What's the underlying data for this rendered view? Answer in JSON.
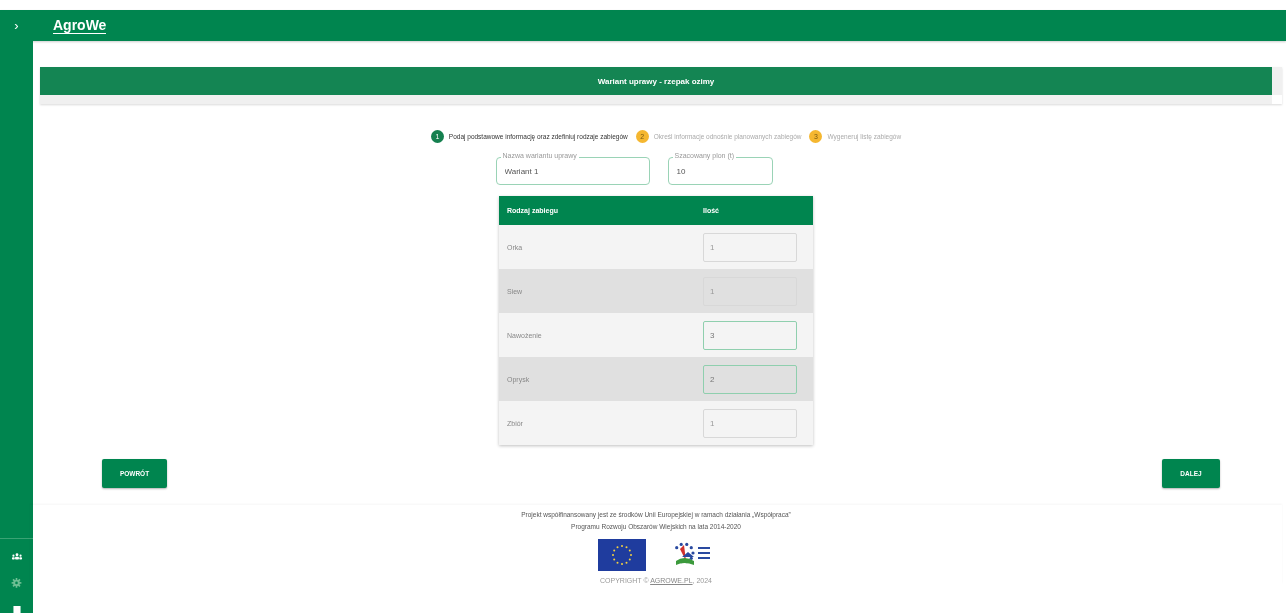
{
  "app": {
    "brand": "AgroWe",
    "menu_toggle": "›"
  },
  "banner": {
    "title": "Wariant uprawy - rzepak ozimy"
  },
  "steps": [
    {
      "number": "1",
      "label": "Podaj podstawowe informację oraz zdefiniuj rodzaje zabiegów",
      "selected": true
    },
    {
      "number": "2",
      "label": "Określ informacje odnośnie planowanych zabiegów",
      "selected": false
    },
    {
      "number": "3",
      "label": "Wygeneruj listę zabiegów",
      "selected": false
    }
  ],
  "fields": [
    {
      "label": "Nazwa wariantu uprawy",
      "value": "Wariant 1"
    },
    {
      "label": "Szacowany plon (t)",
      "value": "10"
    }
  ],
  "table": {
    "columns": [
      "Rodzaj zabiegu",
      "Ilość"
    ],
    "rows": [
      {
        "name": "Orka",
        "value": "1",
        "disabled": true
      },
      {
        "name": "Siew",
        "value": "1",
        "disabled": true
      },
      {
        "name": "Nawożenie",
        "value": "3",
        "disabled": false
      },
      {
        "name": "Oprysk",
        "value": "2",
        "disabled": false
      },
      {
        "name": "Zbiór",
        "value": "1",
        "disabled": true
      }
    ]
  },
  "buttons": {
    "back": "POWRÓT",
    "next": "DALEJ"
  },
  "footer": {
    "text_lines": [
      "Projekt współfinansowany jest ze środków Unii Europejskiej w ramach działania „Współpraca”",
      "Programu Rozwoju Obszarów Wiejskich na lata 2014-2020"
    ],
    "copyright_prefix": "COPYRIGHT © ",
    "copyright_link": "AGROWE.PL",
    "copyright_suffix": ", 2024"
  }
}
